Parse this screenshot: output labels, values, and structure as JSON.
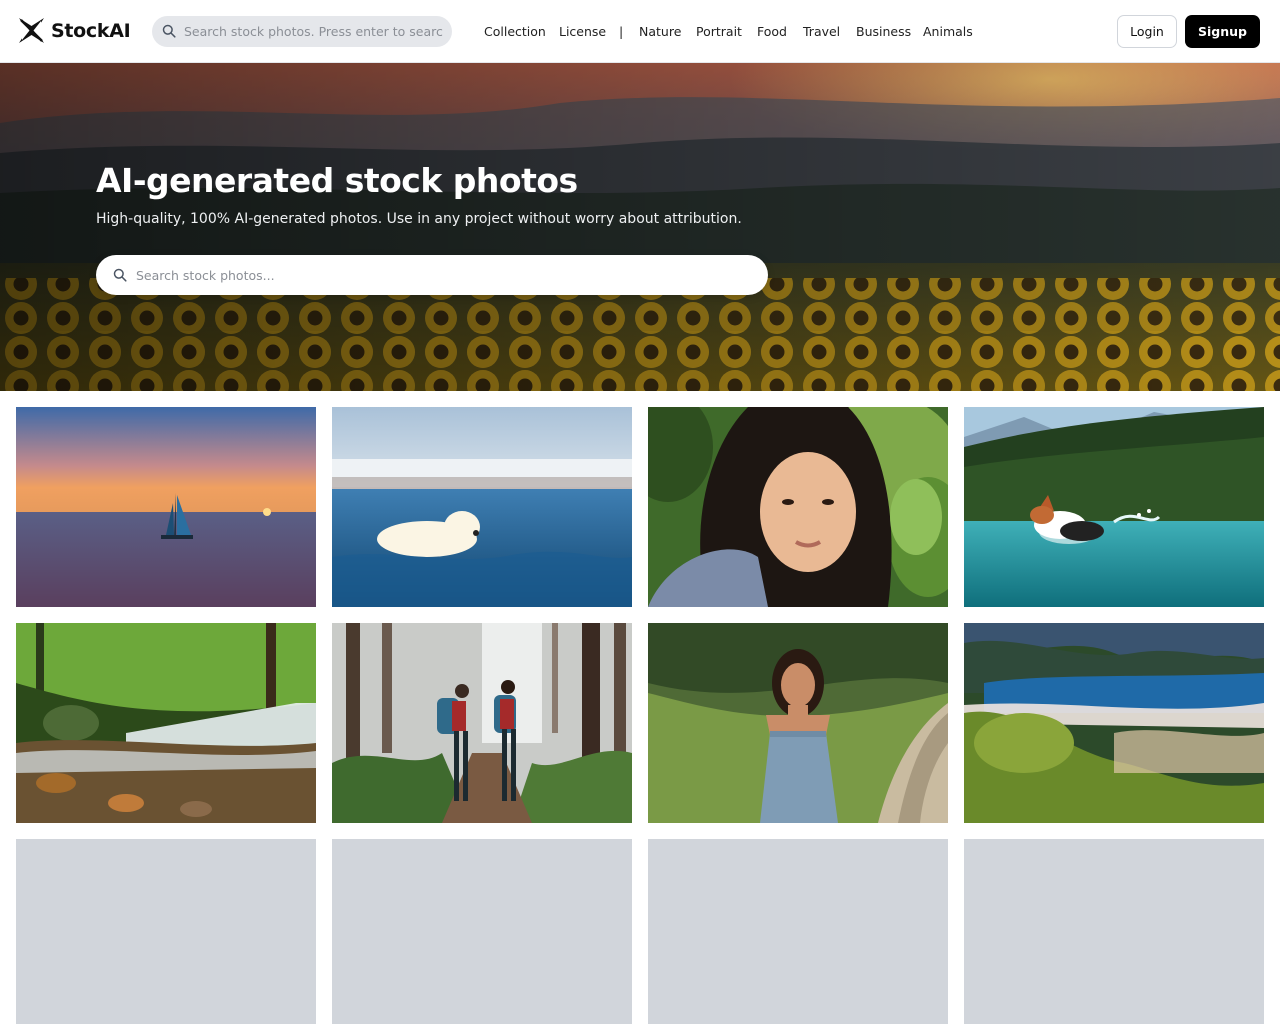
{
  "header": {
    "logo_text": "StockAI",
    "search_placeholder": "Search stock photos. Press enter to search.",
    "nav": [
      "Collection",
      "License",
      "|",
      "Nature",
      "Portrait",
      "Food",
      "Travel",
      "Business",
      "Animals"
    ],
    "login_label": "Login",
    "signup_label": "Signup"
  },
  "hero": {
    "title": "AI-generated stock photos",
    "subtitle": "High-quality, 100% AI-generated photos. Use in any project without worry about attribution.",
    "search_placeholder": "Search stock photos..."
  },
  "gallery": {
    "photos": [
      {
        "subject": "sailboat-at-sunset"
      },
      {
        "subject": "polar-bear-swimming"
      },
      {
        "subject": "woman-portrait-leaves"
      },
      {
        "subject": "dog-splashing-lake"
      },
      {
        "subject": "forest-waterfall"
      },
      {
        "subject": "hikers-foggy-forest"
      },
      {
        "subject": "woman-mountain-trail"
      },
      {
        "subject": "mountain-lake-fog"
      }
    ],
    "loading_placeholders": 4
  },
  "colors": {
    "accent": "#000000",
    "nav_search_bg": "#e5e7eb",
    "placeholder_bg": "#d1d5db"
  },
  "icons": [
    "logo-icon",
    "search-icon"
  ]
}
